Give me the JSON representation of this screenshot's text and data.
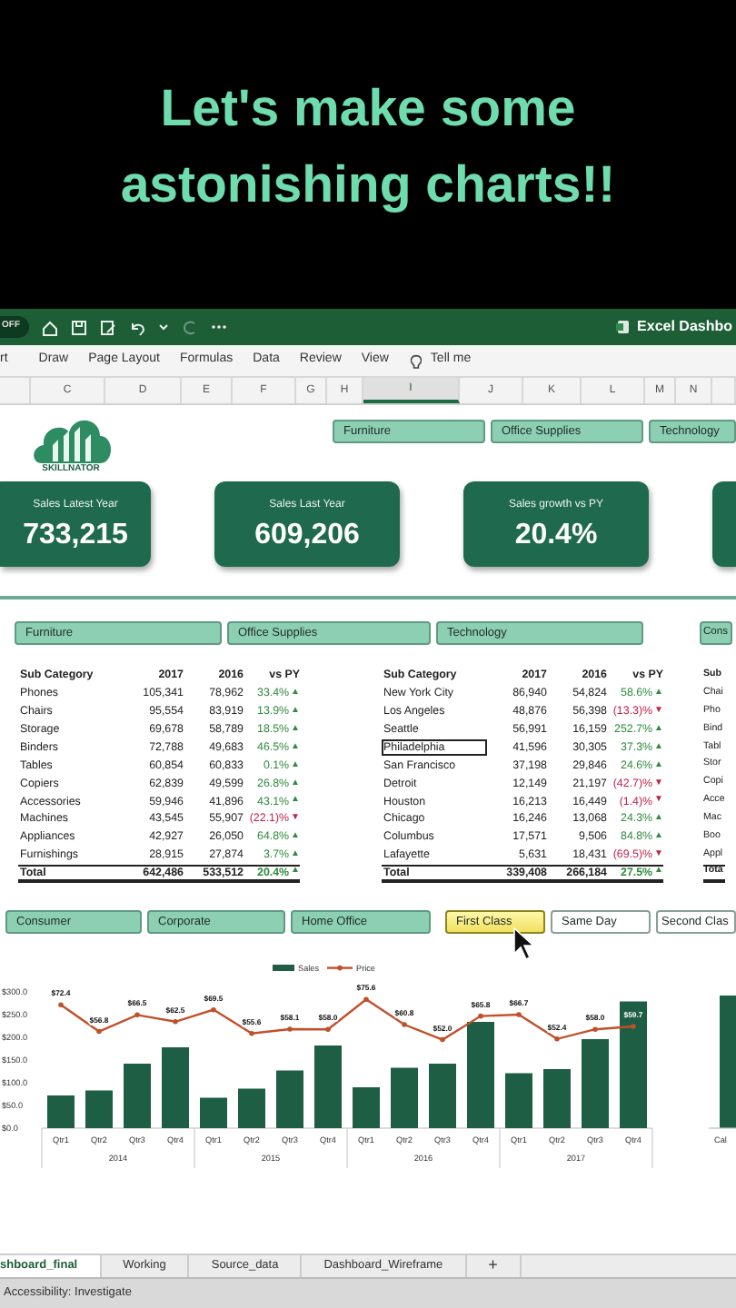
{
  "caption": {
    "lines": [
      "Let's make some",
      "astonishing charts!!"
    ]
  },
  "title_bar": {
    "toggle": "OFF",
    "title": "Excel Dashbo"
  },
  "ribbon": {
    "tabs": [
      "rt",
      "Draw",
      "Page Layout",
      "Formulas",
      "Data",
      "Review",
      "View"
    ],
    "tell_me": "Tell me"
  },
  "columns": [
    {
      "label": "C",
      "selected": false
    },
    {
      "label": "D",
      "selected": false
    },
    {
      "label": "E",
      "selected": false
    },
    {
      "label": "F",
      "selected": false
    },
    {
      "label": "G",
      "selected": false
    },
    {
      "label": "H",
      "selected": false
    },
    {
      "label": "I",
      "selected": true
    },
    {
      "label": "J",
      "selected": false
    },
    {
      "label": "K",
      "selected": false
    },
    {
      "label": "L",
      "selected": false
    },
    {
      "label": "M",
      "selected": false
    },
    {
      "label": "N",
      "selected": false
    }
  ],
  "logo": {
    "name": "SKILLNATOR"
  },
  "category_slicer": [
    {
      "label": "Furniture",
      "selected": true
    },
    {
      "label": "Office Supplies",
      "selected": true
    },
    {
      "label": "Technology",
      "selected": true
    }
  ],
  "kpis": [
    {
      "label": "Sales Latest Year",
      "value": "733,215"
    },
    {
      "label": "Sales Last Year",
      "value": "609,206"
    },
    {
      "label": "Sales growth vs PY",
      "value": "20.4%"
    }
  ],
  "table_slicer": [
    {
      "label": "Furniture",
      "selected": true
    },
    {
      "label": "Office Supplies",
      "selected": true
    },
    {
      "label": "Technology",
      "selected": true
    },
    {
      "label": "Cons",
      "selected": true
    }
  ],
  "tables": [
    {
      "columns": [
        "Sub Category",
        "2017",
        "2016",
        "vs PY"
      ],
      "rows": [
        {
          "name": "Phones",
          "y2017": "105,341",
          "y2016": "78,962",
          "vs_py": "33.4%",
          "arrow": "▲",
          "positive": true,
          "selected": false
        },
        {
          "name": "Chairs",
          "y2017": "95,554",
          "y2016": "83,919",
          "vs_py": "13.9%",
          "arrow": "▲",
          "positive": true,
          "selected": false
        },
        {
          "name": "Storage",
          "y2017": "69,678",
          "y2016": "58,789",
          "vs_py": "18.5%",
          "arrow": "▲",
          "positive": true,
          "selected": false
        },
        {
          "name": "Binders",
          "y2017": "72,788",
          "y2016": "49,683",
          "vs_py": "46.5%",
          "arrow": "▲",
          "positive": true,
          "selected": false
        },
        {
          "name": "Tables",
          "y2017": "60,854",
          "y2016": "60,833",
          "vs_py": "0.1%",
          "arrow": "▲",
          "positive": true,
          "selected": false
        },
        {
          "name": "Copiers",
          "y2017": "62,839",
          "y2016": "49,599",
          "vs_py": "26.8%",
          "arrow": "▲",
          "positive": true,
          "selected": false
        },
        {
          "name": "Accessories",
          "y2017": "59,946",
          "y2016": "41,896",
          "vs_py": "43.1%",
          "arrow": "▲",
          "positive": true,
          "selected": false
        },
        {
          "name": "Machines",
          "y2017": "43,545",
          "y2016": "55,907",
          "vs_py": "(22.1)%",
          "arrow": "▼",
          "positive": false,
          "selected": false
        },
        {
          "name": "Appliances",
          "y2017": "42,927",
          "y2016": "26,050",
          "vs_py": "64.8%",
          "arrow": "▲",
          "positive": true,
          "selected": false
        },
        {
          "name": "Furnishings",
          "y2017": "28,915",
          "y2016": "27,874",
          "vs_py": "3.7%",
          "arrow": "▲",
          "positive": true,
          "selected": false
        }
      ],
      "total": {
        "name": "Total",
        "y2017": "642,486",
        "y2016": "533,512",
        "vs_py": "20.4%",
        "arrow": "▲",
        "positive": true
      }
    },
    {
      "columns": [
        "Sub Category",
        "2017",
        "2016",
        "vs PY"
      ],
      "rows": [
        {
          "name": "New York City",
          "y2017": "86,940",
          "y2016": "54,824",
          "vs_py": "58.6%",
          "arrow": "▲",
          "positive": true,
          "selected": false
        },
        {
          "name": "Los Angeles",
          "y2017": "48,876",
          "y2016": "56,398",
          "vs_py": "(13.3)%",
          "arrow": "▼",
          "positive": false,
          "selected": false
        },
        {
          "name": "Seattle",
          "y2017": "56,991",
          "y2016": "16,159",
          "vs_py": "252.7%",
          "arrow": "▲",
          "positive": true,
          "selected": false
        },
        {
          "name": "Philadelphia",
          "y2017": "41,596",
          "y2016": "30,305",
          "vs_py": "37.3%",
          "arrow": "▲",
          "positive": true,
          "selected": true
        },
        {
          "name": "San Francisco",
          "y2017": "37,198",
          "y2016": "29,846",
          "vs_py": "24.6%",
          "arrow": "▲",
          "positive": true,
          "selected": false
        },
        {
          "name": "Detroit",
          "y2017": "12,149",
          "y2016": "21,197",
          "vs_py": "(42.7)%",
          "arrow": "▼",
          "positive": false,
          "selected": false
        },
        {
          "name": "Houston",
          "y2017": "16,213",
          "y2016": "16,449",
          "vs_py": "(1.4)%",
          "arrow": "▼",
          "positive": false,
          "selected": false
        },
        {
          "name": "Chicago",
          "y2017": "16,246",
          "y2016": "13,068",
          "vs_py": "24.3%",
          "arrow": "▲",
          "positive": true,
          "selected": false
        },
        {
          "name": "Columbus",
          "y2017": "17,571",
          "y2016": "9,506",
          "vs_py": "84.8%",
          "arrow": "▲",
          "positive": true,
          "selected": false
        },
        {
          "name": "Lafayette",
          "y2017": "5,631",
          "y2016": "18,431",
          "vs_py": "(69.5)%",
          "arrow": "▼",
          "positive": false,
          "selected": false
        }
      ],
      "total": {
        "name": "Total",
        "y2017": "339,408",
        "y2016": "266,184",
        "vs_py": "27.5%",
        "arrow": "▲",
        "positive": true
      }
    }
  ],
  "partial_table": {
    "header": "Sub",
    "rows": [
      "Chai",
      "Pho",
      "Bind",
      "Tabl",
      "Stor",
      "Copi",
      "Acce",
      "Mac",
      "Boo",
      "Appl"
    ],
    "total": "Tota"
  },
  "segment_slicer": [
    {
      "label": "Consumer",
      "selected": true,
      "hovered": false
    },
    {
      "label": "Corporate",
      "selected": true,
      "hovered": false
    },
    {
      "label": "Home Office",
      "selected": true,
      "hovered": false
    }
  ],
  "ship_slicer": [
    {
      "label": "First Class",
      "selected": true,
      "hovered": true
    },
    {
      "label": "Same Day",
      "selected": false,
      "hovered": false
    },
    {
      "label": "Second Clas",
      "selected": false,
      "hovered": false
    }
  ],
  "chart": {
    "groups": [
      "2014",
      "2015",
      "2016",
      "2017"
    ],
    "chart_data": {
      "type": "bar",
      "categories": [
        "Qtr1",
        "Qtr2",
        "Qtr3",
        "Qtr4",
        "Qtr1",
        "Qtr2",
        "Qtr3",
        "Qtr4",
        "Qtr1",
        "Qtr2",
        "Qtr3",
        "Qtr4",
        "Qtr1",
        "Qtr2",
        "Qtr3",
        "Qtr4"
      ],
      "series": [
        {
          "name": "Sales",
          "color": "#1e5e45",
          "values": [
            72,
            83,
            142,
            178,
            67,
            87,
            127,
            182,
            90,
            133,
            142,
            234,
            121,
            130,
            196,
            279
          ]
        },
        {
          "name": "Price",
          "type": "line",
          "axis": "y2",
          "color": "#c0502a",
          "values": [
            72.4,
            56.8,
            66.5,
            62.5,
            69.5,
            55.6,
            58.1,
            58.0,
            75.6,
            60.8,
            52.0,
            65.8,
            66.7,
            52.4,
            58.0,
            59.7
          ],
          "value_labels": [
            "$72.4",
            "$56.8",
            "$66.5",
            "$62.5",
            "$69.5",
            "$55.6",
            "$58.1",
            "$58.0",
            "$75.6",
            "$60.8",
            "$52.0",
            "$65.8",
            "$66.7",
            "$52.4",
            "$58.0",
            "$59.7"
          ]
        }
      ],
      "legend": "top",
      "ylim": [
        0,
        300
      ],
      "yticks": [
        {
          "value": 0,
          "label": "$0.0"
        },
        {
          "value": 50,
          "label": "$50.0"
        },
        {
          "value": 100,
          "label": "$100.0"
        },
        {
          "value": 150,
          "label": "$150.0"
        },
        {
          "value": 200,
          "label": "$200.0"
        },
        {
          "value": 250,
          "label": "$250.0"
        },
        {
          "value": 300,
          "label": "$300.0"
        }
      ]
    }
  },
  "side_chart": {
    "label": "Cal"
  },
  "sheet_tabs": [
    {
      "label": "shboard_final",
      "selected": true
    },
    {
      "label": "Working",
      "selected": false
    },
    {
      "label": "Source_data",
      "selected": false
    },
    {
      "label": "Dashboard_Wireframe",
      "selected": false
    }
  ],
  "add_tab": "+",
  "status_bar": {
    "text": "Accessibility: Investigate"
  }
}
